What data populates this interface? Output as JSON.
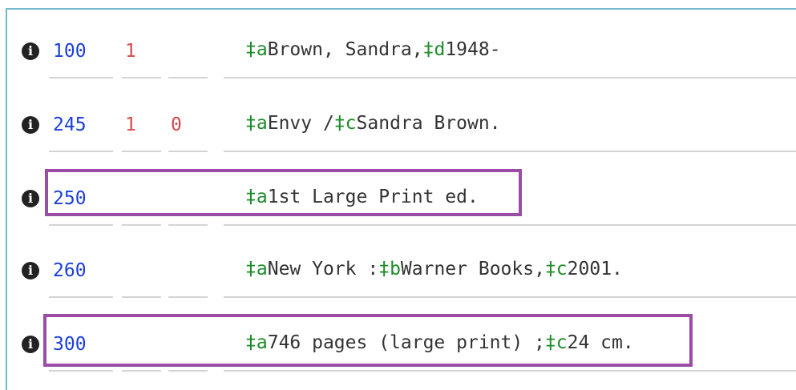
{
  "fields": [
    {
      "tag": "100",
      "ind1": "1",
      "ind2": "",
      "content": [
        {
          "code": "a",
          "text": "Brown, Sandra,"
        },
        {
          "code": "d",
          "text": "1948-"
        }
      ]
    },
    {
      "tag": "245",
      "ind1": "1",
      "ind2": "0",
      "content": [
        {
          "code": "a",
          "text": "Envy /"
        },
        {
          "code": "c",
          "text": "Sandra Brown."
        }
      ]
    },
    {
      "tag": "250",
      "ind1": "",
      "ind2": "",
      "highlighted": true,
      "content": [
        {
          "code": "a",
          "text": "1st Large Print ed."
        }
      ]
    },
    {
      "tag": "260",
      "ind1": "",
      "ind2": "",
      "content": [
        {
          "code": "a",
          "text": "New York :"
        },
        {
          "code": "b",
          "text": "Warner Books,"
        },
        {
          "code": "c",
          "text": "2001."
        }
      ]
    },
    {
      "tag": "300",
      "ind1": "",
      "ind2": "",
      "highlighted": true,
      "content": [
        {
          "code": "a",
          "text": "746 pages (large print) ;"
        },
        {
          "code": "c",
          "text": "24 cm."
        }
      ]
    }
  ],
  "subfield_delimiter": "‡",
  "icons": {
    "info": "info-circle-icon"
  },
  "colors": {
    "tag": "#1a3fd8",
    "indicator": "#d94a4a",
    "subfield_code": "#1e8c2a",
    "content": "#333333",
    "highlight_border": "#9b4da6",
    "frame_border": "#6fb7d3"
  }
}
